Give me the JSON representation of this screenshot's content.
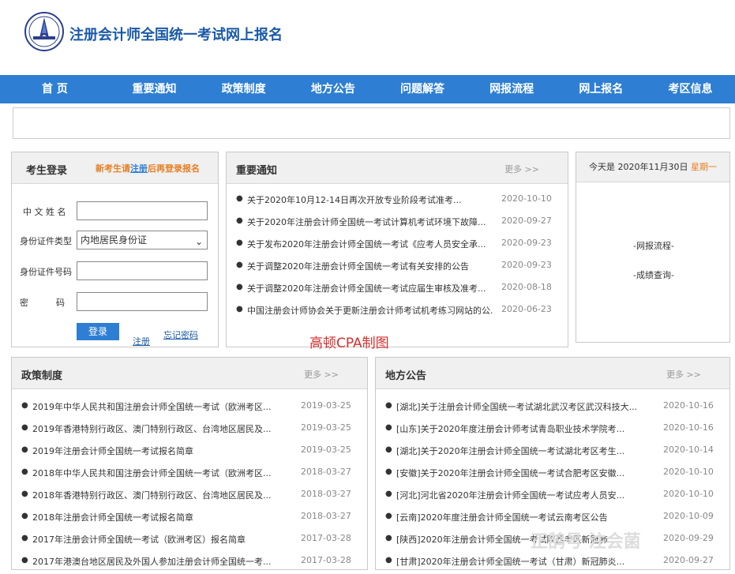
{
  "header": {
    "title": "注册会计师全国统一考试网上报名"
  },
  "nav": [
    "首 页",
    "重要通知",
    "政策制度",
    "地方公告",
    "问题解答",
    "网报流程",
    "网上报名",
    "考区信息"
  ],
  "login": {
    "title": "考生登录",
    "note_prefix": "新考生请",
    "note_link": "注册",
    "note_suffix": "后再登录报名",
    "name_label": "中 文  姓 名",
    "idtype_label": "身份证件类型",
    "idtype_value": "内地居民身份证",
    "idno_label": "身份证件号码",
    "pwd_label": "密          码",
    "login_button": "登录",
    "register_link": "注册",
    "forgot_link": "忘记密码"
  },
  "notices": {
    "title": "重要通知",
    "more": "更多 >>",
    "items": [
      {
        "title": "关于2020年10月12-14日再次开放专业阶段考试准考...",
        "date": "2020-10-10"
      },
      {
        "title": "关于2020年注册会计师全国统一考试计算机考试环境下故障...",
        "date": "2020-09-27"
      },
      {
        "title": "关于发布2020年注册会计师全国统一考试《应考人员安全承...",
        "date": "2020-09-23"
      },
      {
        "title": "关于调整2020年注册会计师全国统一考试有关安排的公告",
        "date": "2020-09-23"
      },
      {
        "title": "关于调整2020年注册会计师全国统一考试应届生审核及准考...",
        "date": "2020-08-18"
      },
      {
        "title": "中国注册会计师协会关于更新注册会计师考试机考练习网站的公...",
        "date": "2020-06-23"
      }
    ]
  },
  "today": {
    "prefix": "今天是 2020年11月30日",
    "weekday": "星期一",
    "link1": "-网报流程-",
    "link2": "-成绩查询-"
  },
  "watermark": "高顿CPA制图",
  "policy": {
    "title": "政策制度",
    "more": "更多 >>",
    "items": [
      {
        "title": "2019年中华人民共和国注册会计师全国统一考试（欧洲考区...",
        "date": "2019-03-25"
      },
      {
        "title": "2019年香港特别行政区、澳门特别行政区、台湾地区居民及...",
        "date": "2019-03-25"
      },
      {
        "title": "2019年注册会计师全国统一考试报名简章",
        "date": "2019-03-25"
      },
      {
        "title": "2018年中华人民共和国注册会计师全国统一考试（欧洲考区...",
        "date": "2018-03-27"
      },
      {
        "title": "2018年香港特别行政区、澳门特别行政区、台湾地区居民及...",
        "date": "2018-03-27"
      },
      {
        "title": "2018年注册会计师全国统一考试报名简章",
        "date": "2018-03-27"
      },
      {
        "title": "2017年注册会计师全国统一考试（欧洲考区）报名简章",
        "date": "2017-03-28"
      },
      {
        "title": "2017年港澳台地区居民及外国人参加注册会计师全国统一考...",
        "date": "2017-03-28"
      }
    ]
  },
  "local": {
    "title": "地方公告",
    "more": "更多 >>",
    "items": [
      {
        "title": "[湖北]关于注册会计师全国统一考试湖北武汉考区武汉科技大...",
        "date": "2020-10-16"
      },
      {
        "title": "[山东]关于2020年度注册会计师考试青岛职业技术学院考...",
        "date": "2020-10-16"
      },
      {
        "title": "[湖北]关于2020年注册会计师全国统一考试湖北考区考生...",
        "date": "2020-10-14"
      },
      {
        "title": "[安徽]关于2020年注册会计师全国统一考试合肥考区安徽...",
        "date": "2020-10-10"
      },
      {
        "title": "[河北]河北省2020年注册会计师全国统一考试应考人员安...",
        "date": "2020-10-10"
      },
      {
        "title": "[云南]2020年度注册会计师全国统一考试云南考区公告",
        "date": "2020-10-09"
      },
      {
        "title": "[陕西]2020年注册会计师全国统一考试陕西考区新冠肺...",
        "date": "2020-09-29"
      },
      {
        "title": "[甘肃]2020年注册会计师全国统一考试（甘肃）新冠肺炎...",
        "date": "2020-09-27"
      }
    ]
  },
  "corner_watermark": "正鹄号 注会菌"
}
